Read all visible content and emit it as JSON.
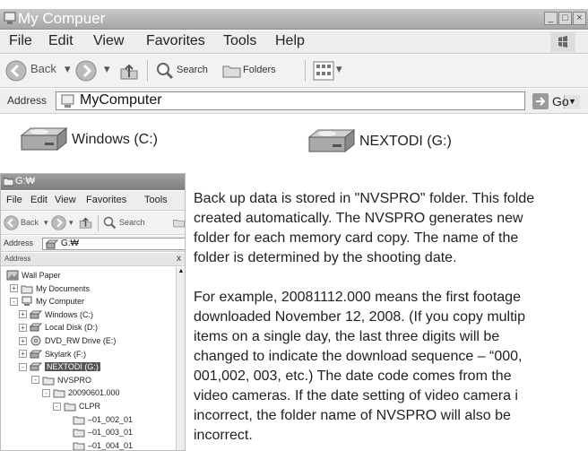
{
  "main_window": {
    "title": "My Compuer",
    "controls": [
      "_",
      "□",
      "×"
    ],
    "menu": [
      "File",
      "Edit",
      "View",
      "Favorites",
      "Tools",
      "Help"
    ],
    "toolbar": {
      "back": "Back",
      "search": "Search",
      "folders": "Folders"
    },
    "address": {
      "label": "Address",
      "value": "MyComputer",
      "go": "Go"
    },
    "drives": [
      {
        "label": "Windows (C:)",
        "icon": "hard-drive-icon"
      },
      {
        "label": "NEXTODI (G:)",
        "icon": "hard-drive-icon"
      }
    ]
  },
  "explorer_window": {
    "title": "G:₩",
    "menu": [
      "File",
      "Edit",
      "View",
      "Favorites",
      "Tools"
    ],
    "toolbar": {
      "back": "Back",
      "search": "Search"
    },
    "address": {
      "label": "Address",
      "value": "G:₩"
    },
    "panel": {
      "title": "Address",
      "close": "x"
    },
    "tree": [
      {
        "label": "Wall Paper",
        "expander": "",
        "icon": "wallpaper-icon",
        "selected": false
      },
      {
        "label": "My Documents",
        "expander": "+",
        "icon": "folder-icon",
        "selected": false
      },
      {
        "label": "My Computer",
        "expander": "-",
        "icon": "computer-icon",
        "selected": false
      },
      {
        "label": "Windows (C:)",
        "expander": "+",
        "icon": "drive-icon",
        "selected": false
      },
      {
        "label": "Local Disk (D:)",
        "expander": "+",
        "icon": "drive-icon",
        "selected": false
      },
      {
        "label": "DVD_RW Drive (E:)",
        "expander": "+",
        "icon": "dvd-icon",
        "selected": false
      },
      {
        "label": "Skylark (F:)",
        "expander": "+",
        "icon": "drive-icon",
        "selected": false
      },
      {
        "label": "NEXTODI (G:)",
        "expander": "-",
        "icon": "drive-icon",
        "selected": true
      },
      {
        "label": "NVSPRO",
        "expander": "-",
        "icon": "folder-icon",
        "selected": false
      },
      {
        "label": "20090601.000",
        "expander": "-",
        "icon": "folder-icon",
        "selected": false
      },
      {
        "label": "CLPR",
        "expander": "-",
        "icon": "folder-icon",
        "selected": false
      },
      {
        "label": "–01_002_01",
        "expander": "",
        "icon": "folder-icon",
        "selected": false
      },
      {
        "label": "–01_003_01",
        "expander": "",
        "icon": "folder-icon",
        "selected": false
      },
      {
        "label": "–01_004_01",
        "expander": "",
        "icon": "folder-icon",
        "selected": false
      }
    ]
  },
  "instructions": {
    "paragraph1": [
      "Back up data is stored in \"NVSPRO\" folder. This folde",
      "created automatically. The NVSPRO generates new",
      "folder for each memory card copy. The name of the",
      "folder is determined by the shooting date."
    ],
    "paragraph2": [
      "For example, 20081112.000 means the first footage",
      "downloaded November 12, 2008.  (If you copy multip",
      "items on a single day, the last three digits will be",
      "changed to indicate the download sequence – “000,",
      "001,002, 003, etc.) The date code comes from the",
      "video cameras. If the date setting of video camera i",
      "incorrect, the folder name of NVSPRO will also be",
      "incorrect."
    ]
  },
  "colors": {
    "titlebar": "#a8a8a8",
    "selected": "#555555",
    "background": "#ffffff"
  }
}
